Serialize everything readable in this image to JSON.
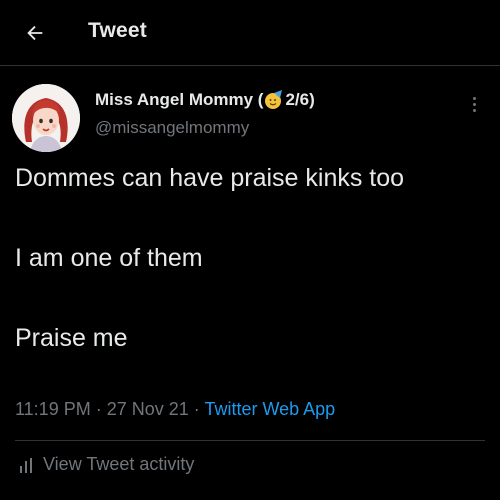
{
  "header": {
    "back_icon": "arrow-left-icon",
    "title": "Tweet"
  },
  "tweet": {
    "author": {
      "display_name_prefix": "Miss Angel Mommy (",
      "display_name_emoji": "face-with-party-hat-icon",
      "display_name_suffix": "2/6)",
      "username": "@missangelmommy",
      "avatar": "avatar-redhead-illustration"
    },
    "more_icon": "more-vertical-icon",
    "text": {
      "line1": "Dommes can have praise kinks too",
      "line2": "I am one of them",
      "line3": "Praise me"
    },
    "meta": {
      "time": "11:19 PM",
      "separator1": " · ",
      "date": "27 Nov 21",
      "separator2": " · ",
      "source": "Twitter Web App"
    },
    "activity": {
      "icon": "bar-chart-icon",
      "label": "View Tweet activity"
    }
  },
  "colors": {
    "background": "#000000",
    "primary_text": "#e7e9ea",
    "secondary_text": "#71767b",
    "link": "#1d9bf0",
    "divider": "#2f3336"
  }
}
